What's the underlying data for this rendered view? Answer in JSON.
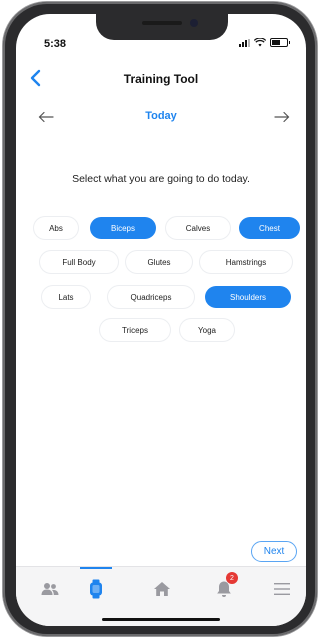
{
  "status": {
    "time": "5:38"
  },
  "header": {
    "title": "Training Tool",
    "back_icon": "chevron-left-icon"
  },
  "date_nav": {
    "label": "Today",
    "prev_icon": "arrow-left-icon",
    "next_icon": "arrow-right-icon"
  },
  "prompt": "Select what you are going to do today.",
  "muscle_groups": [
    {
      "label": "Abs",
      "selected": false
    },
    {
      "label": "Biceps",
      "selected": true
    },
    {
      "label": "Calves",
      "selected": false
    },
    {
      "label": "Chest",
      "selected": true
    },
    {
      "label": "Full Body",
      "selected": false
    },
    {
      "label": "Glutes",
      "selected": false
    },
    {
      "label": "Hamstrings",
      "selected": false
    },
    {
      "label": "Lats",
      "selected": false
    },
    {
      "label": "Quadriceps",
      "selected": false
    },
    {
      "label": "Shoulders",
      "selected": true
    },
    {
      "label": "Triceps",
      "selected": false
    },
    {
      "label": "Yoga",
      "selected": false
    }
  ],
  "next_button": {
    "label": "Next"
  },
  "tabbar": {
    "active": "watch",
    "tabs": [
      {
        "id": "people",
        "icon": "people-icon"
      },
      {
        "id": "watch",
        "icon": "watch-icon"
      },
      {
        "id": "home",
        "icon": "home-icon"
      },
      {
        "id": "notifications",
        "icon": "bell-icon",
        "badge": "2"
      },
      {
        "id": "menu",
        "icon": "menu-icon"
      }
    ]
  },
  "colors": {
    "accent": "#1f84ee",
    "badge": "#e53935",
    "chip_text": "#222222"
  }
}
